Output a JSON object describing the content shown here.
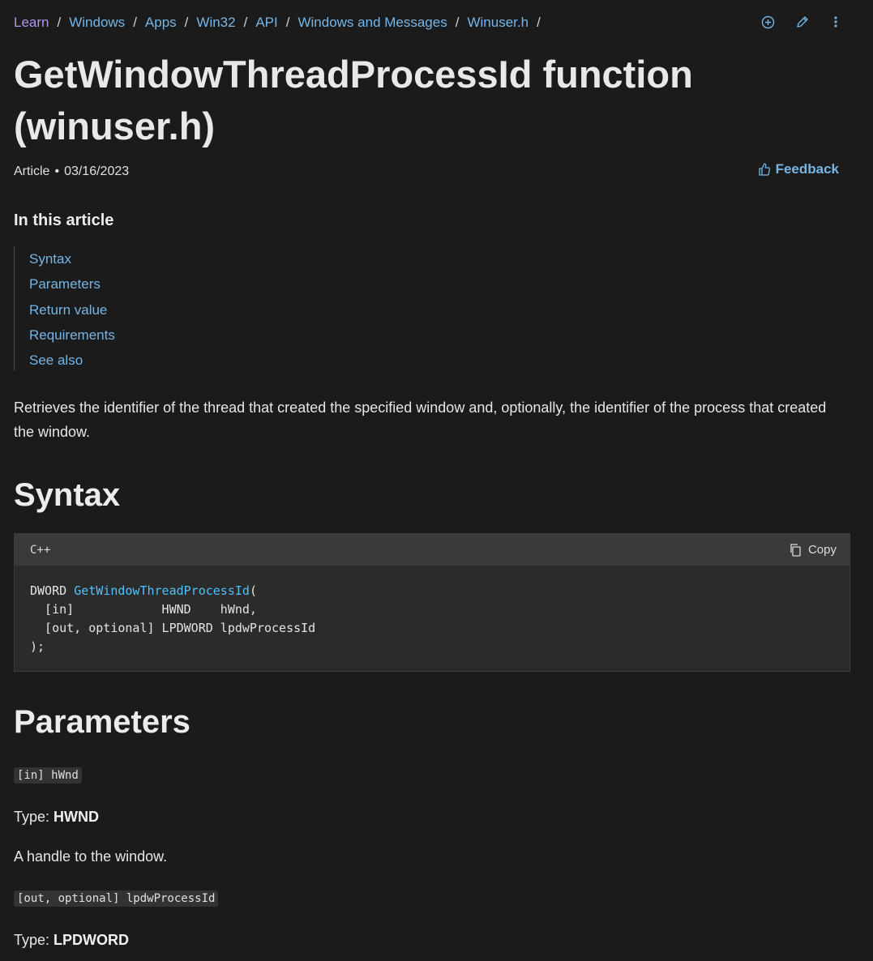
{
  "breadcrumb": {
    "items": [
      "Learn",
      "Windows",
      "Apps",
      "Win32",
      "API",
      "Windows and Messages",
      "Winuser.h"
    ],
    "separator": "/"
  },
  "top_actions": [
    "add-collection-icon",
    "edit-icon",
    "more-options-icon"
  ],
  "title": "GetWindowThreadProcessId function (winuser.h)",
  "meta": {
    "type": "Article",
    "date": "03/16/2023"
  },
  "feedback_label": "Feedback",
  "toc": {
    "heading": "In this article",
    "items": [
      "Syntax",
      "Parameters",
      "Return value",
      "Requirements",
      "See also"
    ]
  },
  "summary": "Retrieves the identifier of the thread that created the specified window and, optionally, the identifier of the process that created the window.",
  "syntax": {
    "heading": "Syntax",
    "language": "C++",
    "copy_label": "Copy",
    "code": {
      "return_type": "DWORD ",
      "function_name": "GetWindowThreadProcessId",
      "open": "(",
      "lines": [
        "  [in]            HWND    hWnd,",
        "  [out, optional] LPDWORD lpdwProcessId",
        ");"
      ]
    }
  },
  "parameters": {
    "heading": "Parameters",
    "items": [
      {
        "name": "[in] hWnd",
        "type_label": "Type: ",
        "type": "HWND",
        "description": "A handle to the window."
      },
      {
        "name": "[out, optional] lpdwProcessId",
        "type_label": "Type: ",
        "type": "LPDWORD"
      }
    ]
  },
  "colors": {
    "background": "#1b1b1b",
    "link": "#75b6e7",
    "visited": "#b294f0",
    "code_function": "#4fc1ff"
  }
}
